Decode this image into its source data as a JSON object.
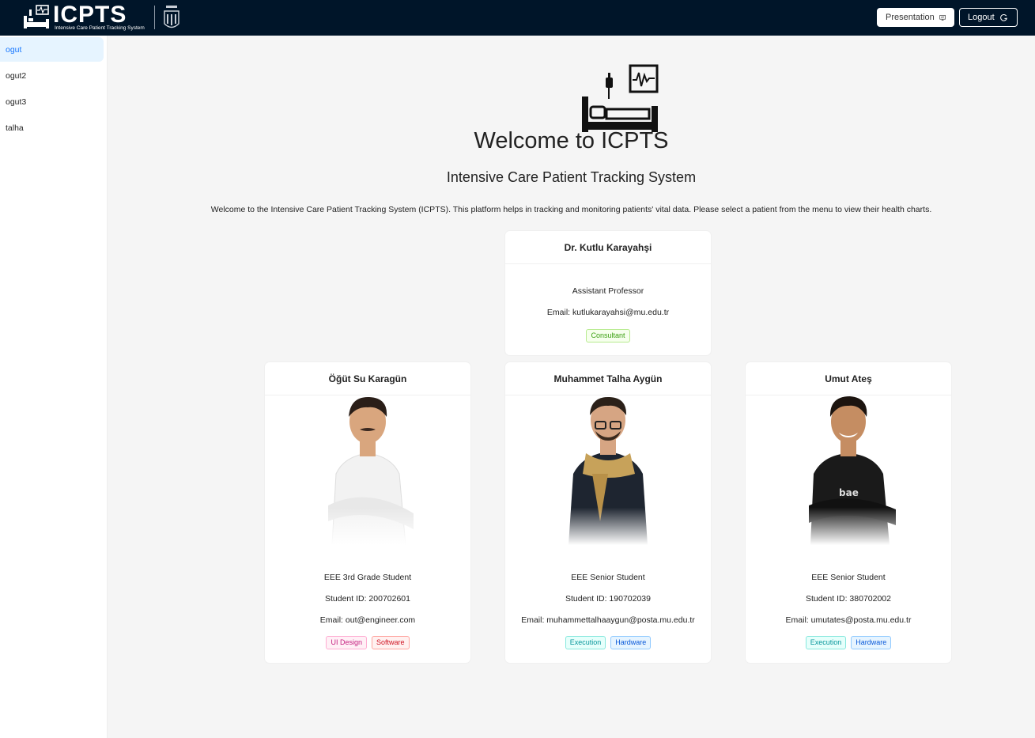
{
  "header": {
    "logo_text": "ICPTS",
    "logo_subtitle": "Intensive Care Patient Tracking System",
    "presentation_label": "Presentation",
    "logout_label": "Logout"
  },
  "sidebar": {
    "items": [
      {
        "label": "ogut",
        "active": true
      },
      {
        "label": "ogut2"
      },
      {
        "label": "ogut3"
      },
      {
        "label": "talha"
      }
    ]
  },
  "main": {
    "title": "Welcome to ICPTS",
    "subtitle": "Intensive Care Patient Tracking System",
    "intro": "Welcome to the Intensive Care Patient Tracking System (ICPTS). This platform helps in tracking and monitoring patients' vital data. Please select a patient from the menu to view their health charts."
  },
  "consultant": {
    "name": "Dr. Kutlu Karayahşi",
    "role": "Assistant Professor",
    "email": "Email: kutlukarayahsi@mu.edu.tr",
    "tag": "Consultant"
  },
  "team": [
    {
      "name": "Öğüt Su Karagün",
      "role": "EEE 3rd Grade Student",
      "student_id": "Student ID: 200702601",
      "email": "Email: out@engineer.com",
      "tags": [
        "UI Design",
        "Software"
      ],
      "shirt": "#f2f2f2"
    },
    {
      "name": "Muhammet Talha Aygün",
      "role": "EEE Senior Student",
      "student_id": "Student ID: 190702039",
      "email": "Email: muhammettalhaaygun@posta.mu.edu.tr",
      "tags": [
        "Execution",
        "Hardware"
      ],
      "shirt": "#1e2530"
    },
    {
      "name": "Umut Ateş",
      "role": "EEE Senior Student",
      "student_id": "Student ID: 380702002",
      "email": "Email: umutates@posta.mu.edu.tr",
      "tags": [
        "Execution",
        "Hardware"
      ],
      "shirt": "#1a1a1a"
    }
  ],
  "colors": {
    "header_bg": "#001529",
    "accent": "#1677ff",
    "active_bg": "#e6f4ff"
  }
}
